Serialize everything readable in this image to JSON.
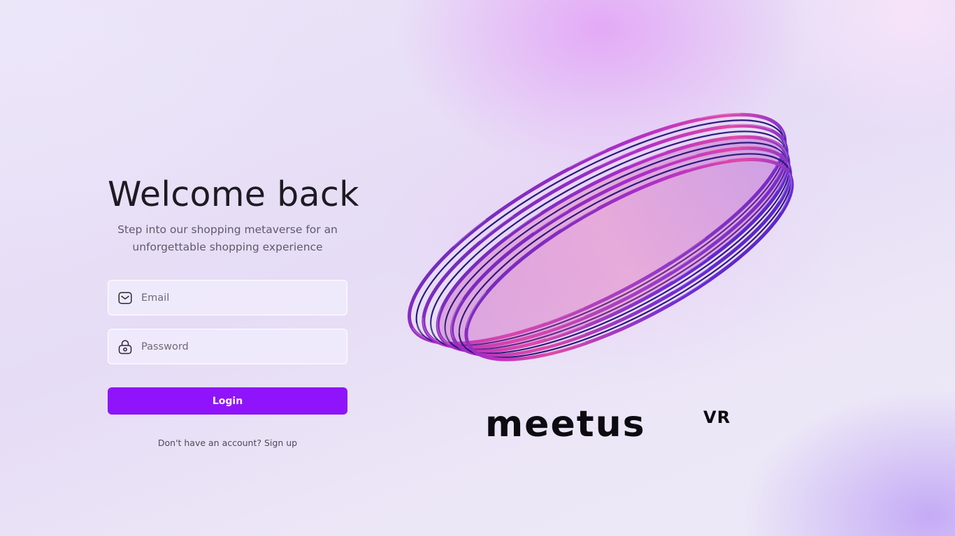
{
  "login": {
    "title": "Welcome back",
    "subtitle": "Step into our shopping metaverse for an unforgettable shopping experience",
    "email_placeholder": "Email",
    "password_placeholder": "Password",
    "login_label": "Login",
    "signup_prompt": "Don't have an account?",
    "signup_link": "Sign up"
  },
  "brand": {
    "logo_text": "meetus",
    "logo_suffix": "VR"
  },
  "icons": {
    "email": "mail-icon",
    "password": "lock-icon"
  },
  "colors": {
    "accent": "#8f14fc",
    "title": "#1d1b22",
    "subtitle": "#5f5a6b",
    "ring_primary": "#6b2bd6",
    "ring_secondary": "#d43aa8"
  }
}
